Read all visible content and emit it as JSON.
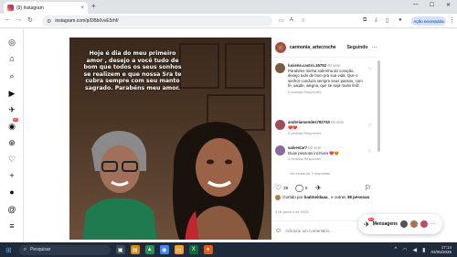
{
  "browser": {
    "tab_title": "(9) Instagram",
    "tab_close": "×",
    "new_tab": "+",
    "url": "instagram.com/p/DBb0vvE5rhf/",
    "update_label": "Ação necessária",
    "window_minimize": "—",
    "window_maximize": "☐",
    "window_close": "✕"
  },
  "rail": {
    "notification_badge": "9+"
  },
  "post": {
    "image_text": "Hoje é  dia do meu primeiro amor , desejo a você tudo de bom que todos os seus sonhos se realizem e que nossa Sra te cubra sempre com seu manto sagrado. Parabéns meu amor.",
    "author": "carmonia_artecroche",
    "follow_label": "Seguindo",
    "more": "···"
  },
  "comments": [
    {
      "user": "luciene.castro.16752",
      "time": "60 sem",
      "text": "Parabéns minha sobrinha do coração, desejo tudo de bom pra sua vida. Que o senhor conduza sempre seus passos, com fé, saúde, alegria, que se seja muito feliz.",
      "meta": "2 curtidas   Responder",
      "avatar_color": "#7a5a44"
    },
    {
      "user": "andreiamendes792740",
      "time": "60 sem",
      "text": "❤️❤️",
      "meta": "2 curtidas   Responder",
      "avatar_color": "#a04c5a"
    },
    {
      "user": "salvestar7",
      "time": "60 sem",
      "text": "Duas pessoas incríveis ❤️😍",
      "meta": "2 curtidas   Responder",
      "avatar_color": "#8a6a9a"
    }
  ],
  "view_replies": "Ver todas as 3 respostas",
  "actions": {
    "likes_count": "39",
    "comments_count": "5"
  },
  "likes_text_prefix": "Curtido por ",
  "likes_text_user": "lualmeidaaa_",
  "likes_text_suffix": " e outras ",
  "likes_text_others": "38 pessoas",
  "date": "3 de janeiro de 2025",
  "comment_placeholder": "Adicione um comentário...",
  "messages": {
    "label": "Mensagens",
    "badge": "9+",
    "more": "···"
  },
  "taskbar": {
    "search_label": "Pesquisar",
    "time": "17:14",
    "date": "03/05/2026"
  },
  "colors": {
    "instagram_red": "#ff3040",
    "link_blue": "#0095f6"
  }
}
